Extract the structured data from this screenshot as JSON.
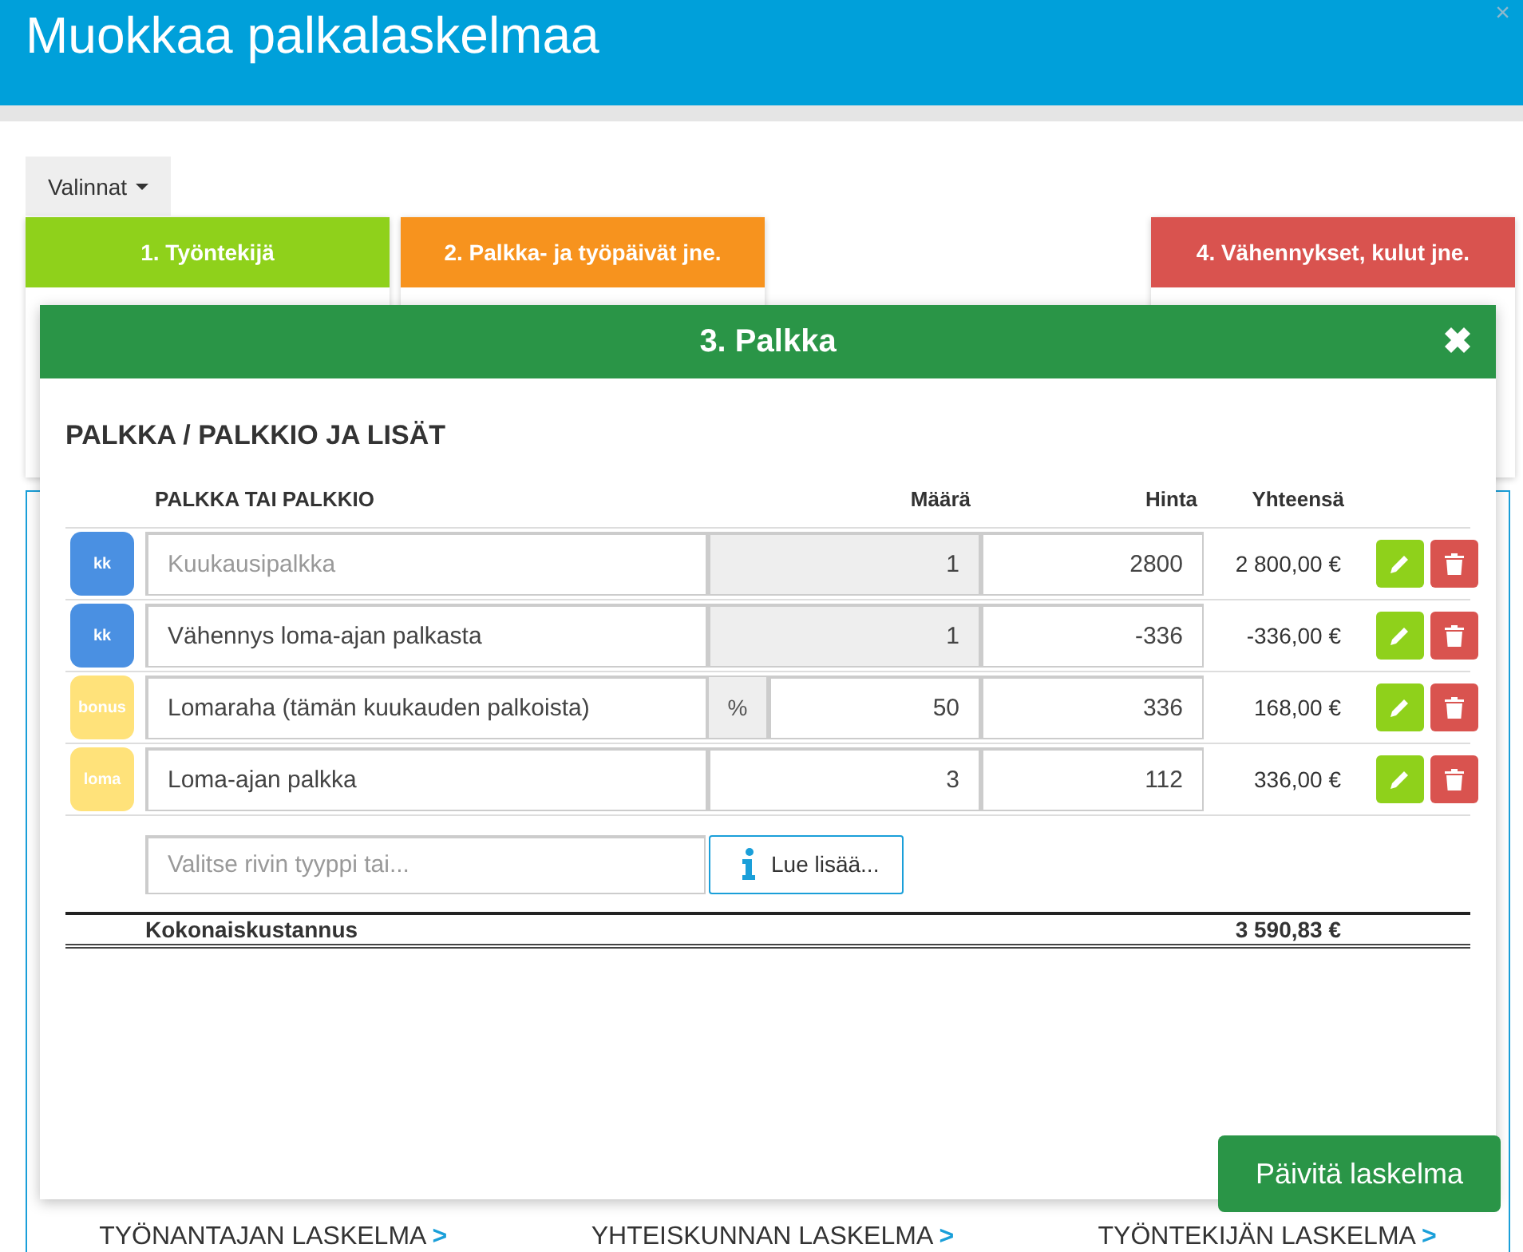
{
  "window": {
    "title": "Muokkaa palkalaskelmaa",
    "close": "×"
  },
  "menu_button": {
    "label": "Valinnat"
  },
  "steps": [
    {
      "label": "1. Työntekijä",
      "color": "#8fd11b"
    },
    {
      "label": "2. Palkka- ja työpäivät jne.",
      "color": "#f7931e"
    },
    {
      "label": "4. Vähennykset, kulut jne.",
      "color": "#d9534f"
    }
  ],
  "report_links": [
    {
      "label": "TYÖNANTAJAN LASKELMA",
      "arrow": ">"
    },
    {
      "label": "YHTEISKUNNAN LASKELMA",
      "arrow": ">"
    },
    {
      "label": "TYÖNTEKIJÄN LASKELMA",
      "arrow": ">"
    }
  ],
  "dialog": {
    "title": "3. Palkka",
    "section_title": "PALKKA / PALKKIO JA LISÄT",
    "columns": [
      "PALKKA TAI PALKKIO",
      "Määrä",
      "Hinta",
      "Yhteensä"
    ],
    "rows": [
      {
        "badge": "kk",
        "color": "#4a90e2",
        "name": {
          "placeholder": "Kuukausipalkka"
        },
        "quantity": "1",
        "disabled": true,
        "price": "2800",
        "total": "2 800,00 €"
      },
      {
        "badge": "kk",
        "color": "#4a90e2",
        "name": {
          "value": "Vähennys loma-ajan palkasta"
        },
        "quantity": "1",
        "disabled": true,
        "price": "-336",
        "total": "-336,00 €"
      },
      {
        "badge": "bonus",
        "color": "#ffe27a",
        "name": {
          "value": "Lomaraha (tämän kuukauden palkoista)"
        },
        "unit": "%",
        "quantity": "50",
        "disabled": false,
        "price": "336",
        "total": "168,00 €"
      },
      {
        "badge": "loma",
        "color": "#ffe27a",
        "name": {
          "value": "Loma-ajan palkka"
        },
        "quantity": "3",
        "disabled": false,
        "price": "112",
        "total": "336,00 €"
      }
    ],
    "new_row": {
      "placeholder": "Valitse rivin tyyppi tai...",
      "info_button": "Lue lisää..."
    },
    "total": {
      "label": "Kokonaiskustannus",
      "value": "3 590,83 €"
    },
    "submit": "Päivitä laskelma"
  }
}
